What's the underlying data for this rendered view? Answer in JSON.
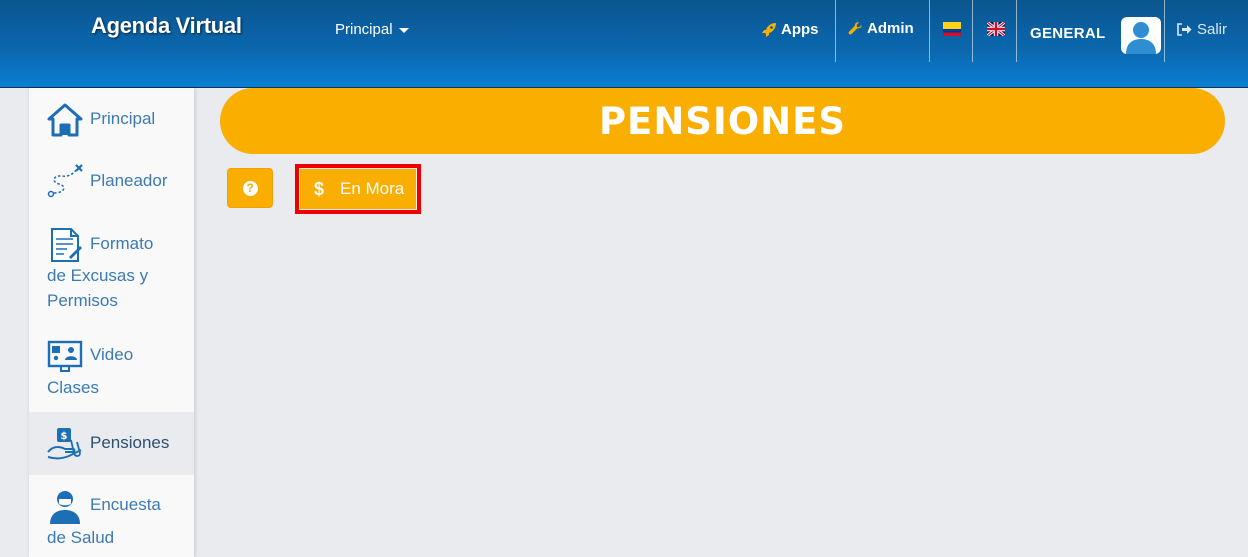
{
  "navbar": {
    "brand": "Agenda Virtual",
    "menu_principal": "Principal",
    "apps": "Apps",
    "admin": "Admin",
    "user": "GENERAL",
    "salir": "Salir"
  },
  "sidebar": {
    "items": [
      {
        "label": "Principal",
        "icon": "home-icon"
      },
      {
        "label": "Planeador",
        "icon": "route-map-icon"
      },
      {
        "label_line1": "Formato",
        "label_rest": "de Excusas y",
        "label_rest2": "Permisos",
        "icon": "document-icon"
      },
      {
        "label_line1": "Video",
        "label_rest": "Clases",
        "icon": "video-class-icon"
      },
      {
        "label": "Pensiones",
        "icon": "payment-hand-icon",
        "active": true
      },
      {
        "label_line1": "Encuesta",
        "label_rest": "de Salud",
        "icon": "health-survey-icon"
      }
    ]
  },
  "main": {
    "title": "PENSIONES",
    "help_icon": "?",
    "mora_button": "En Mora",
    "mora_icon": "$"
  },
  "colors": {
    "navbar": "#0b66ad",
    "accent": "#f9ae00",
    "highlight": "#ee0000",
    "link": "#3c7ab2"
  }
}
